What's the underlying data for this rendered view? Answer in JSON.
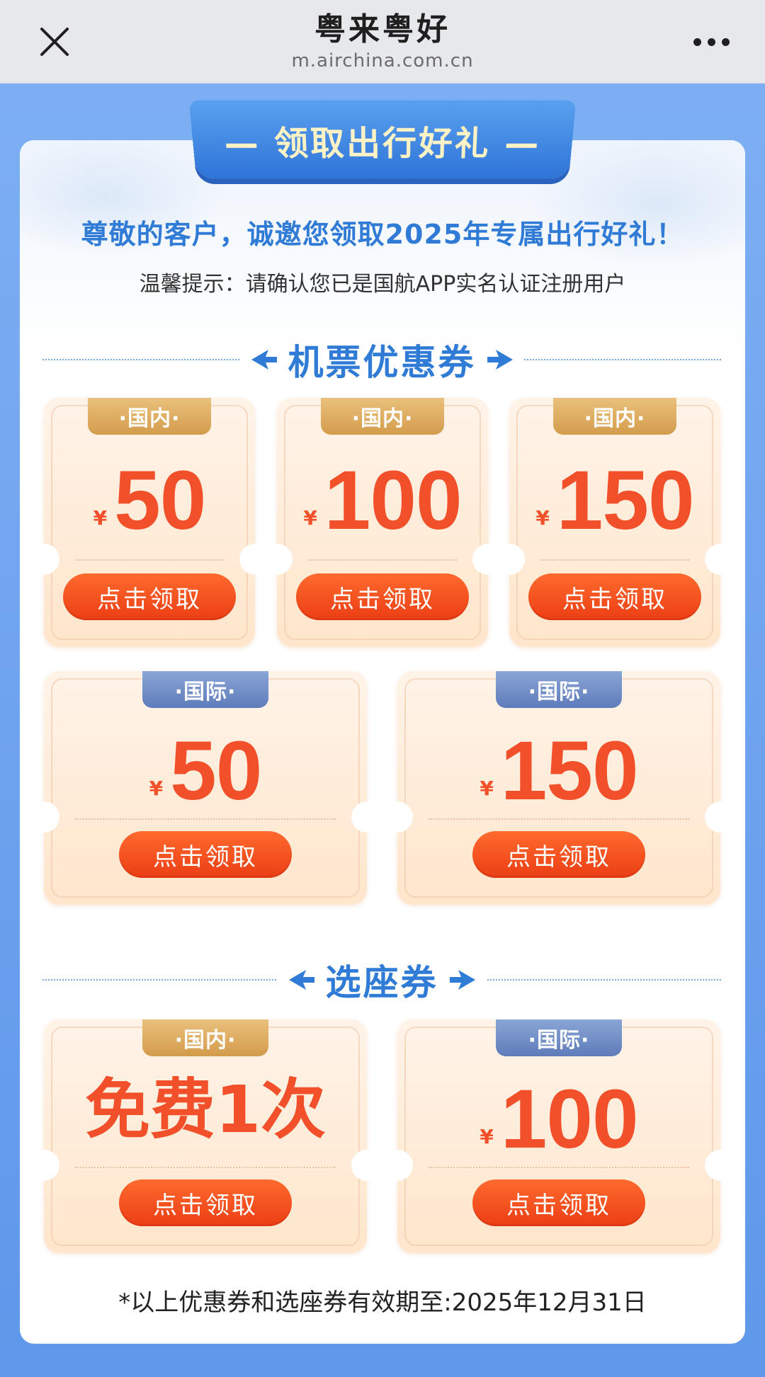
{
  "topbar": {
    "title": "粤来粤好",
    "url": "m.airchina.com.cn"
  },
  "banner": {
    "ribbon_text": "— 领取出行好礼 —",
    "greeting": "尊敬的客户，诚邀您领取2025年专属出行好礼！",
    "tip": "温馨提示：请确认您已是国航APP实名认证注册用户"
  },
  "sections": {
    "ticket": {
      "title": "机票优惠券"
    },
    "seat": {
      "title": "选座券"
    }
  },
  "ticket_coupons": [
    {
      "tag": "·国内·",
      "currency": "¥",
      "amount": "50",
      "button": "点击领取"
    },
    {
      "tag": "·国内·",
      "currency": "¥",
      "amount": "100",
      "button": "点击领取"
    },
    {
      "tag": "·国内·",
      "currency": "¥",
      "amount": "150",
      "button": "点击领取"
    },
    {
      "tag": "·国际·",
      "currency": "¥",
      "amount": "50",
      "button": "点击领取"
    },
    {
      "tag": "·国际·",
      "currency": "¥",
      "amount": "150",
      "button": "点击领取"
    }
  ],
  "seat_coupons": [
    {
      "tag": "·国内·",
      "text": "免费1次",
      "button": "点击领取"
    },
    {
      "tag": "·国际·",
      "currency": "¥",
      "amount": "100",
      "button": "点击领取"
    }
  ],
  "footnote": "*以上优惠券和选座券有效期至:2025年12月31日",
  "colors": {
    "accent_blue": "#2f7bd6",
    "coupon_red": "#f1502a",
    "domestic_tag": "#d49c4c",
    "international_tag": "#5e7cba"
  },
  "icons": [
    "close-icon",
    "more-icon",
    "plane-left-icon",
    "plane-right-icon"
  ]
}
